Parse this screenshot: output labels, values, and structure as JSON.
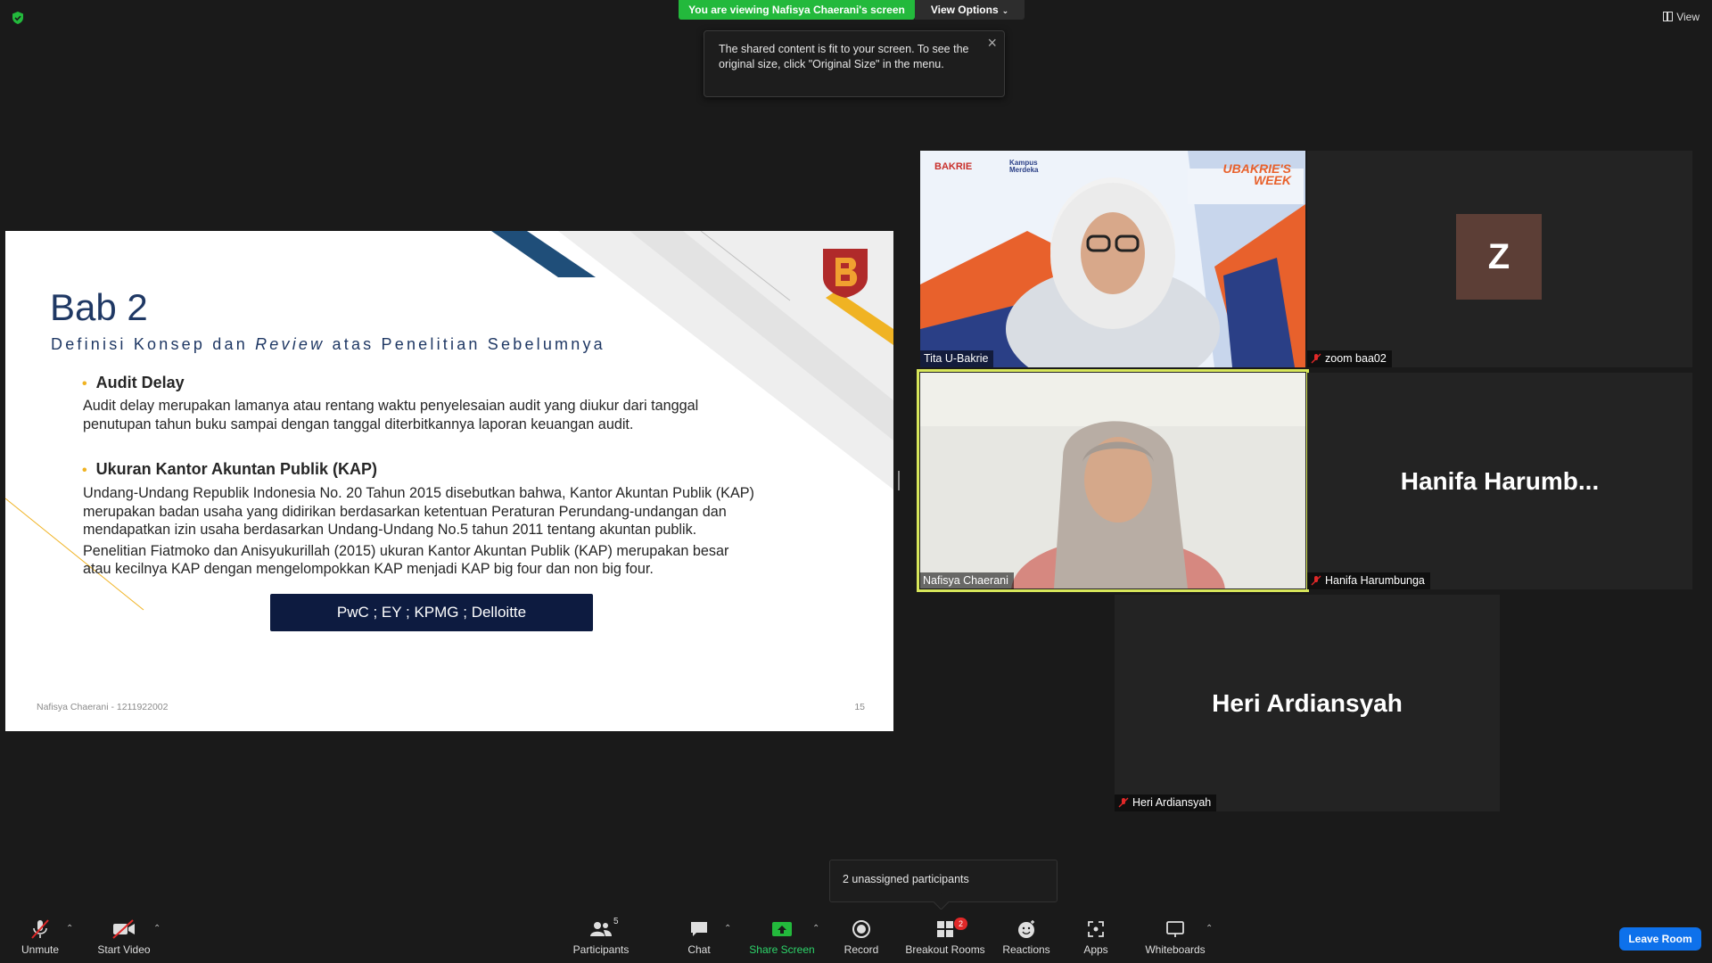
{
  "top": {
    "viewing_banner": "You are viewing Nafisya Chaerani's screen",
    "view_options": "View Options",
    "view_label": "View",
    "tooltip": "The shared content is fit to your screen. To see the original size, click \"Original Size\" in the menu."
  },
  "slide": {
    "title": "Bab 2",
    "subtitle_pre": "Definisi Konsep dan ",
    "subtitle_em": "Review",
    "subtitle_post": " atas Penelitian Sebelumnya",
    "bullet1_head": "Audit Delay",
    "bullet1_text_1": "Audit delay merupakan lamanya atau rentang waktu penyelesaian audit yang diukur dari tanggal",
    "bullet1_text_2": "penutupan tahun buku sampai dengan tanggal diterbitkannya laporan keuangan audit.",
    "bullet2_head": "Ukuran Kantor Akuntan Publik (KAP)",
    "bullet2_text_1": "Undang-Undang Republik Indonesia No. 20 Tahun 2015 disebutkan bahwa, Kantor Akuntan Publik (KAP)",
    "bullet2_text_2": "merupakan badan usaha yang didirikan berdasarkan ketentuan Peraturan Perundang-undangan dan",
    "bullet2_text_3": "mendapatkan izin usaha berdasarkan Undang-Undang No.5 tahun 2011 tentang akuntan publik.",
    "bullet2_text_4": "Penelitian Fiatmoko dan Anisyukurillah (2015) ukuran Kantor Akuntan Publik (KAP) merupakan besar",
    "bullet2_text_5": "atau kecilnya KAP dengan mengelompokkan KAP menjadi KAP big four dan non big four.",
    "box_text": "PwC ; EY ; KPMG ; Delloitte",
    "footer": "Nafisya Chaerani - 1211922002",
    "page_number": "15"
  },
  "participants": [
    {
      "name": "Tita U-Bakrie",
      "muted": false
    },
    {
      "name": "zoom baa02",
      "muted": true,
      "avatar_letter": "Z"
    },
    {
      "name": "Nafisya Chaerani",
      "muted": false,
      "active_speaker": true
    },
    {
      "name": "Hanifa Harumbunga",
      "muted": true,
      "display_name": "Hanifa  Harumb..."
    },
    {
      "name": "Heri Ardiansyah",
      "muted": true,
      "display_name": "Heri Ardiansyah"
    }
  ],
  "video_banner": {
    "brand_left": "BAKRIE",
    "brand_mid_1": "Kampus",
    "brand_mid_2": "Merdeka",
    "event_1": "UBAKRIE'S",
    "event_2": "WEEK"
  },
  "unassigned": "2 unassigned participants",
  "toolbar": {
    "unmute": "Unmute",
    "start_video": "Start Video",
    "participants": "Participants",
    "participants_count": "5",
    "chat": "Chat",
    "share_screen": "Share Screen",
    "record": "Record",
    "breakout_rooms": "Breakout Rooms",
    "breakout_badge": "2",
    "reactions": "Reactions",
    "apps": "Apps",
    "whiteboards": "Whiteboards",
    "leave": "Leave Room"
  },
  "colors": {
    "banner_green": "#23b93c",
    "active_speaker": "#d7e65a",
    "leave_blue": "#0e71eb",
    "slide_navy": "#1f3864",
    "bullet_gold": "#f0b323"
  }
}
